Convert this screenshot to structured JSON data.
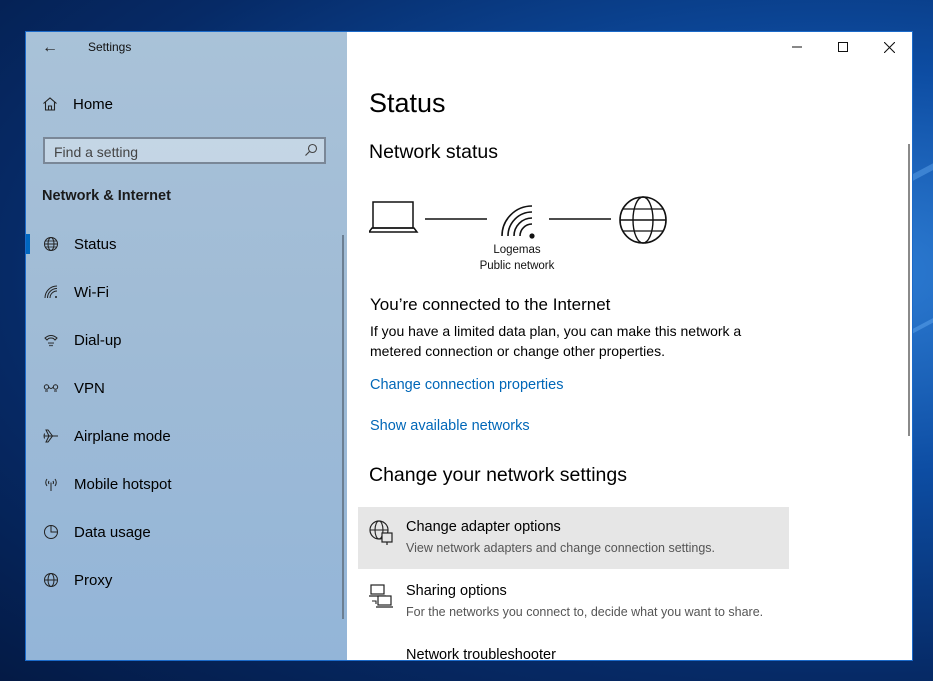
{
  "window": {
    "title": "Settings",
    "back_label": "←"
  },
  "sidebar": {
    "home_label": "Home",
    "search_placeholder": "Find a setting",
    "section_header": "Network & Internet",
    "items": [
      {
        "label": "Status",
        "icon": "globe-icon",
        "active": true
      },
      {
        "label": "Wi-Fi",
        "icon": "wifi-icon"
      },
      {
        "label": "Dial-up",
        "icon": "phone-icon"
      },
      {
        "label": "VPN",
        "icon": "vpn-icon"
      },
      {
        "label": "Airplane mode",
        "icon": "airplane-icon"
      },
      {
        "label": "Mobile hotspot",
        "icon": "hotspot-icon"
      },
      {
        "label": "Data usage",
        "icon": "pie-chart-icon"
      },
      {
        "label": "Proxy",
        "icon": "globe-icon"
      }
    ]
  },
  "main": {
    "page_title": "Status",
    "network_status_heading": "Network status",
    "network_name": "Logemas",
    "network_type": "Public network",
    "connected_title": "You’re connected to the Internet",
    "connected_desc": "If you have a limited data plan, you can make this network a metered connection or change other properties.",
    "link_change_props": "Change connection properties",
    "link_show_networks": "Show available networks",
    "change_settings_heading": "Change your network settings",
    "options": [
      {
        "title": "Change adapter options",
        "desc": "View network adapters and change connection settings.",
        "icon": "adapter-icon"
      },
      {
        "title": "Sharing options",
        "desc": "For the networks you connect to, decide what you want to share.",
        "icon": "sharing-icon"
      },
      {
        "title": "Network troubleshooter",
        "desc": "",
        "icon": "warning-icon"
      }
    ]
  },
  "colors": {
    "accent": "#0067c0",
    "link": "#0067b8"
  }
}
